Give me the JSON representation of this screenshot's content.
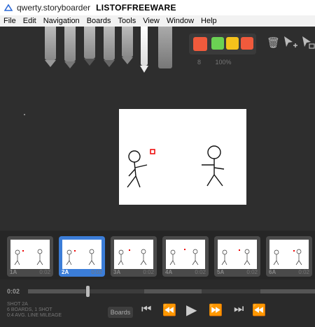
{
  "titlebar": {
    "app": "qwerty.storyboarder",
    "watermark": "LISTOFFREEWARE"
  },
  "menu": [
    "File",
    "Edit",
    "Navigation",
    "Boards",
    "Tools",
    "View",
    "Window",
    "Help"
  ],
  "tools": [
    "light-pencil",
    "pencil",
    "pen",
    "brush",
    "note-pen",
    "eraser"
  ],
  "swatches": {
    "colors": [
      "#f05a3c",
      "#6bd153",
      "#f5c21b",
      "#f05a3c"
    ],
    "brush_size": "8",
    "opacity": "100%"
  },
  "thumbnails": [
    {
      "label": "1A",
      "duration": "0:02"
    },
    {
      "label": "2A",
      "duration": "0:02",
      "selected": true
    },
    {
      "label": "3A",
      "duration": "0:02"
    },
    {
      "label": "4A",
      "duration": "0:02"
    },
    {
      "label": "5A",
      "duration": "0:02"
    },
    {
      "label": "6A",
      "duration": "0:02"
    }
  ],
  "timeline": {
    "current_time": "0:02"
  },
  "info": [
    "SHOT 2A",
    "6 BOARDS, 1 SHOT",
    "0:4 AVG. LINE MILEAGE"
  ],
  "controls": {
    "boards_label": "Boards"
  }
}
